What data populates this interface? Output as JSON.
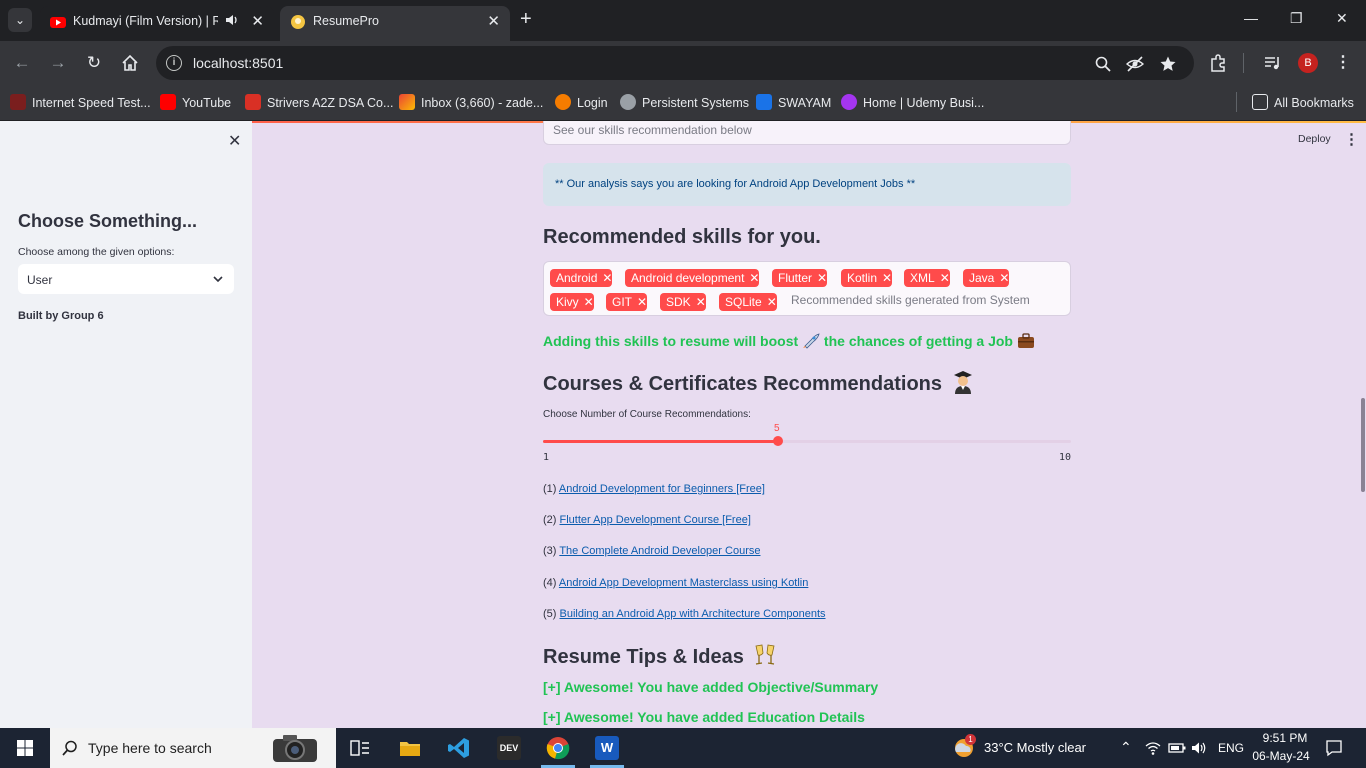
{
  "browser": {
    "tabs": [
      {
        "title": "Kudmayi (Film Version) | Ro",
        "active": false
      },
      {
        "title": "ResumePro",
        "active": true
      }
    ],
    "url": "localhost:8501",
    "bookmarks": [
      "Internet Speed Test...",
      "YouTube",
      "Strivers A2Z DSA Co...",
      "Inbox (3,660) - zade...",
      "Login",
      "Persistent Systems",
      "SWAYAM",
      "Home | Udemy Busi..."
    ],
    "all_bookmarks": "All Bookmarks",
    "profile_initial": "B"
  },
  "sidebar": {
    "title": "Choose Something...",
    "select_label": "Choose among the given options:",
    "select_value": "User",
    "footer": "Built by Group 6"
  },
  "header": {
    "deploy": "Deploy"
  },
  "main": {
    "textarea_placeholder": "See our skills recommendation below",
    "info": "** Our analysis says you are looking for Android App Development Jobs **",
    "skills_heading": "Recommended skills for you.",
    "skills": [
      "Android",
      "Android development",
      "Flutter",
      "Kotlin",
      "XML",
      "Java",
      "Kivy",
      "GIT",
      "SDK",
      "SQLite"
    ],
    "skills_placeholder": "Recommended skills generated from System",
    "boost_text_1": "Adding this skills to resume will boost",
    "boost_text_2": " the chances of getting a Job",
    "courses_heading": "Courses & Certificates Recommendations",
    "slider": {
      "label": "Choose Number of Course Recommendations:",
      "value": 5,
      "min": 1,
      "max": 10
    },
    "courses": [
      {
        "num": "(1)",
        "title": "Android Development for Beginners [Free]"
      },
      {
        "num": "(2)",
        "title": "Flutter App Development Course [Free]"
      },
      {
        "num": "(3)",
        "title": "The Complete Android Developer Course"
      },
      {
        "num": "(4)",
        "title": "Android App Development Masterclass using Kotlin"
      },
      {
        "num": "(5)",
        "title": "Building an Android App with Architecture Components"
      }
    ],
    "tips_heading": "Resume Tips & Ideas",
    "tips": [
      "[+] Awesome! You have added Objective/Summary",
      "[+] Awesome! You have added Education Details"
    ]
  },
  "taskbar": {
    "search_placeholder": "Type here to search",
    "weather": "33°C  Mostly clear",
    "weather_badge": "1",
    "language": "ENG",
    "time": "9:51 PM",
    "date": "06-May-24"
  },
  "colors": {
    "accent": "#ff4b4b",
    "success": "#21c354",
    "page_bg": "#e8dcf0",
    "sidebar_bg": "#f0f2f6"
  }
}
